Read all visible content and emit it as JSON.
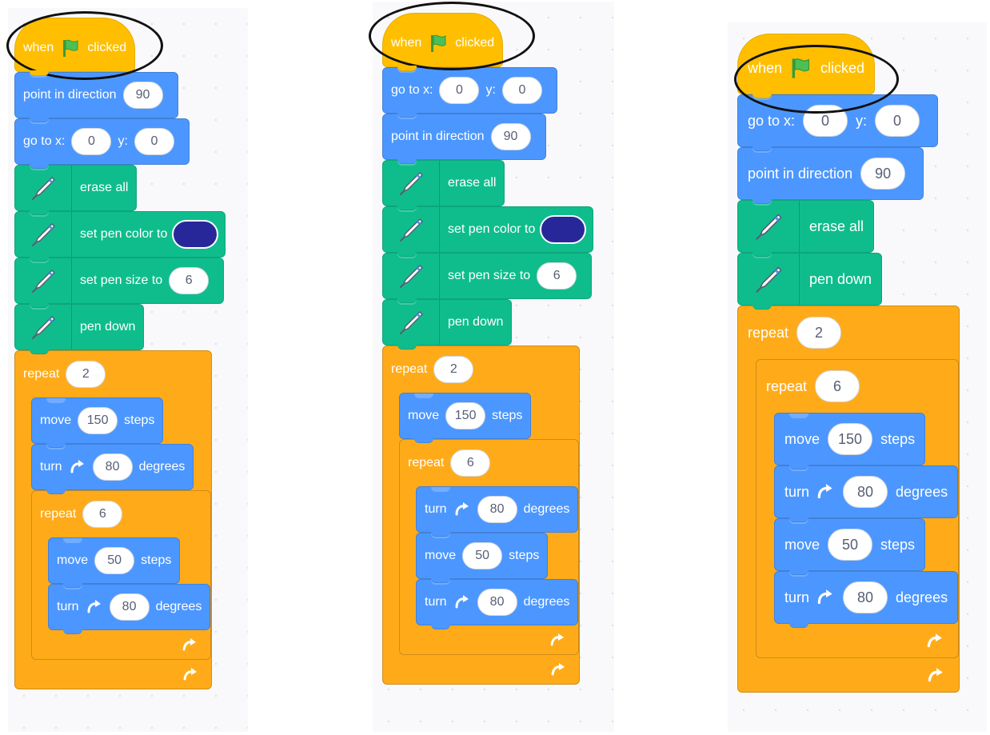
{
  "colors": {
    "events": "#ffbf00",
    "motion": "#4c97ff",
    "pen": "#0fbd8c",
    "control": "#ffab19",
    "pen_color_swatch": "#28279a",
    "workspace": "#f9f9fb",
    "highlight_ellipse": "#111111"
  },
  "icons": {
    "flag": "green-flag-icon",
    "pen": "pen-icon",
    "turn": "turn-clockwise-icon",
    "loop": "loop-arrow-icon"
  },
  "script_1": {
    "hat": {
      "when": "when",
      "clicked": "clicked"
    },
    "point": {
      "label": "point in direction",
      "value": "90"
    },
    "goto": {
      "label": "go to x:",
      "x": "0",
      "y_label": "y:",
      "y": "0"
    },
    "erase": {
      "label": "erase all"
    },
    "color": {
      "label": "set pen color to"
    },
    "size": {
      "label": "set pen size to",
      "value": "6"
    },
    "pendown": {
      "label": "pen down"
    },
    "repeat_outer": {
      "label": "repeat",
      "value": "2"
    },
    "move_a": {
      "label": "move",
      "value": "150",
      "suffix": "steps"
    },
    "turn_a": {
      "label": "turn",
      "value": "80",
      "suffix": "degrees"
    },
    "repeat_inner": {
      "label": "repeat",
      "value": "6"
    },
    "move_b": {
      "label": "move",
      "value": "50",
      "suffix": "steps"
    },
    "turn_b": {
      "label": "turn",
      "value": "80",
      "suffix": "degrees"
    }
  },
  "script_2": {
    "hat": {
      "when": "when",
      "clicked": "clicked"
    },
    "goto": {
      "label": "go to x:",
      "x": "0",
      "y_label": "y:",
      "y": "0"
    },
    "point": {
      "label": "point in direction",
      "value": "90"
    },
    "erase": {
      "label": "erase all"
    },
    "color": {
      "label": "set pen color to"
    },
    "size": {
      "label": "set pen size to",
      "value": "6"
    },
    "pendown": {
      "label": "pen down"
    },
    "repeat_outer": {
      "label": "repeat",
      "value": "2"
    },
    "move_a": {
      "label": "move",
      "value": "150",
      "suffix": "steps"
    },
    "repeat_inner": {
      "label": "repeat",
      "value": "6"
    },
    "turn_a": {
      "label": "turn",
      "value": "80",
      "suffix": "degrees"
    },
    "move_b": {
      "label": "move",
      "value": "50",
      "suffix": "steps"
    },
    "turn_b": {
      "label": "turn",
      "value": "80",
      "suffix": "degrees"
    }
  },
  "script_3": {
    "hat": {
      "when": "when",
      "clicked": "clicked"
    },
    "goto": {
      "label": "go to x:",
      "x": "0",
      "y_label": "y:",
      "y": "0"
    },
    "point": {
      "label": "point in direction",
      "value": "90"
    },
    "erase": {
      "label": "erase all"
    },
    "pendown": {
      "label": "pen down"
    },
    "repeat_outer": {
      "label": "repeat",
      "value": "2"
    },
    "repeat_inner": {
      "label": "repeat",
      "value": "6"
    },
    "move_a": {
      "label": "move",
      "value": "150",
      "suffix": "steps"
    },
    "turn_a": {
      "label": "turn",
      "value": "80",
      "suffix": "degrees"
    },
    "move_b": {
      "label": "move",
      "value": "50",
      "suffix": "steps"
    },
    "turn_b": {
      "label": "turn",
      "value": "80",
      "suffix": "degrees"
    }
  }
}
